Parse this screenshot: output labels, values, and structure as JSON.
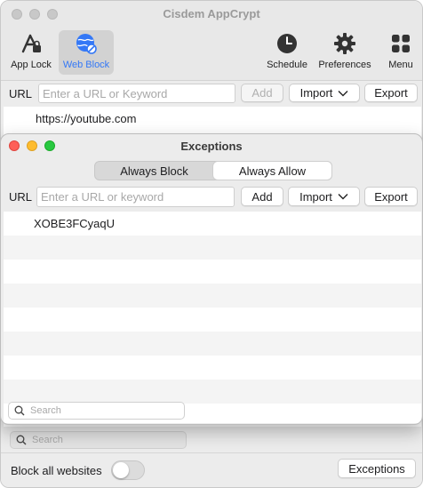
{
  "app": {
    "title": "Cisdem AppCrypt",
    "toolbar": {
      "app_lock": "App Lock",
      "web_block": "Web Block",
      "schedule": "Schedule",
      "preferences": "Preferences",
      "menu": "Menu"
    },
    "url_bar": {
      "label": "URL",
      "placeholder": "Enter a URL or Keyword",
      "add": "Add",
      "import": "Import",
      "export": "Export"
    },
    "entries": [
      "https://youtube.com"
    ],
    "search_placeholder": "Search",
    "block_all_label": "Block all websites",
    "block_all_enabled": false,
    "exceptions_button": "Exceptions"
  },
  "exceptions": {
    "title": "Exceptions",
    "tabs": [
      "Always Block",
      "Always Allow"
    ],
    "active_tab": "Always Allow",
    "url_bar": {
      "label": "URL",
      "placeholder": "Enter a URL or keyword",
      "add": "Add",
      "import": "Import",
      "export": "Export"
    },
    "entries": [
      "XOBE3FCyaqU"
    ],
    "search_placeholder": "Search"
  },
  "colors": {
    "accent": "#3478f6",
    "close": "#fe5f57",
    "minimize": "#febc2e",
    "zoom": "#28c840"
  }
}
